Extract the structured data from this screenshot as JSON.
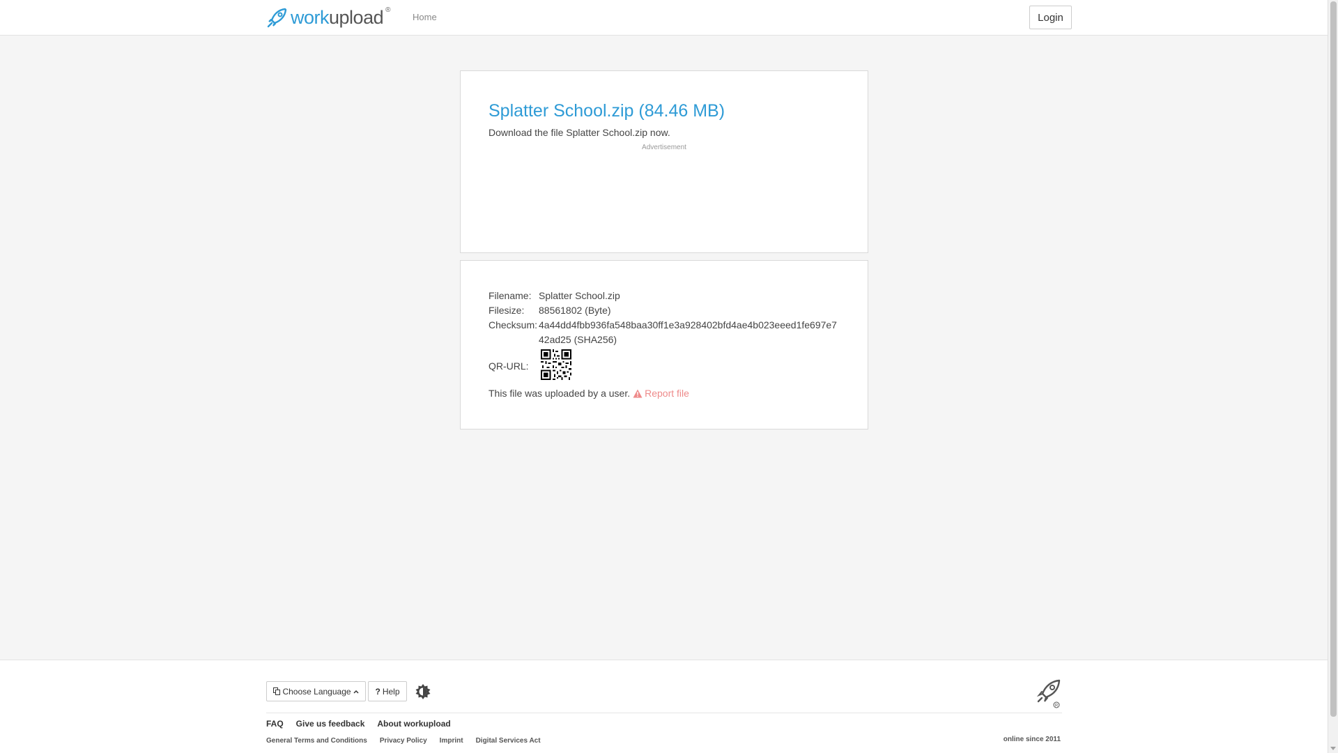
{
  "header": {
    "brand_work": "work",
    "brand_upload": "upload",
    "brand_reg": "®",
    "nav_home": "Home",
    "login_label": "Login"
  },
  "download": {
    "title": "Splatter School.zip (84.46 MB)",
    "subtitle": "Download the file Splatter School.zip now.",
    "ad_label": "Advertisement"
  },
  "file_info": {
    "filename_label": "Filename:",
    "filename_value": "Splatter School.zip",
    "filesize_label": "Filesize:",
    "filesize_value": "88561802 (Byte)",
    "checksum_label": "Checksum:",
    "checksum_line1": "4a44dd4fbb936fa548baa30ff1e3a928402bfd4ae4b023eeed1fe697e7",
    "checksum_line2": "42ad25 (SHA256)",
    "qr_label": "QR-URL:",
    "uploaded_text": "This file was uploaded by a user.",
    "report_label": "Report file"
  },
  "footer": {
    "language_label": "Choose Language",
    "help_label": "Help",
    "links_primary": [
      "FAQ",
      "Give us feedback",
      "About workupload"
    ],
    "links_secondary": [
      "General Terms and Conditions",
      "Privacy Policy",
      "Imprint",
      "Digital Services Act"
    ],
    "online_since": "online since 2011"
  },
  "colors": {
    "accent": "#2e9bd6",
    "report": "#ee8a8a"
  },
  "icons": [
    "rocket-logo-icon",
    "qr-code-icon",
    "warning-icon",
    "language-icon",
    "chevron-up-icon",
    "question-icon",
    "theme-toggle-icon",
    "footer-rocket-icon"
  ]
}
